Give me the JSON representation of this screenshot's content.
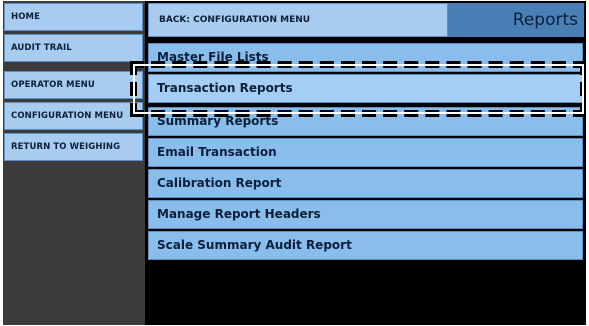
{
  "sidebar": {
    "items": [
      {
        "label": "HOME"
      },
      {
        "label": "AUDIT TRAIL"
      },
      {
        "label": "OPERATOR MENU"
      },
      {
        "label": "CONFIGURATION MENU"
      },
      {
        "label": "RETURN TO WEIGHING"
      }
    ]
  },
  "header": {
    "back_label": "BACK: CONFIGURATION MENU",
    "title": "Reports"
  },
  "menu": {
    "items": [
      {
        "label": "Master File Lists"
      },
      {
        "label": "Transaction Reports"
      },
      {
        "label": "Summary Reports"
      },
      {
        "label": "Email Transaction"
      },
      {
        "label": "Calibration Report"
      },
      {
        "label": "Manage Report Headers"
      },
      {
        "label": "Scale Summary Audit Report"
      }
    ]
  },
  "colors": {
    "button": "#a8ccf0",
    "menu_item": "#89bdec",
    "title_bg": "#4a7fb5",
    "sidebar_bg": "#3c3c3c",
    "content_bg": "#000000"
  }
}
